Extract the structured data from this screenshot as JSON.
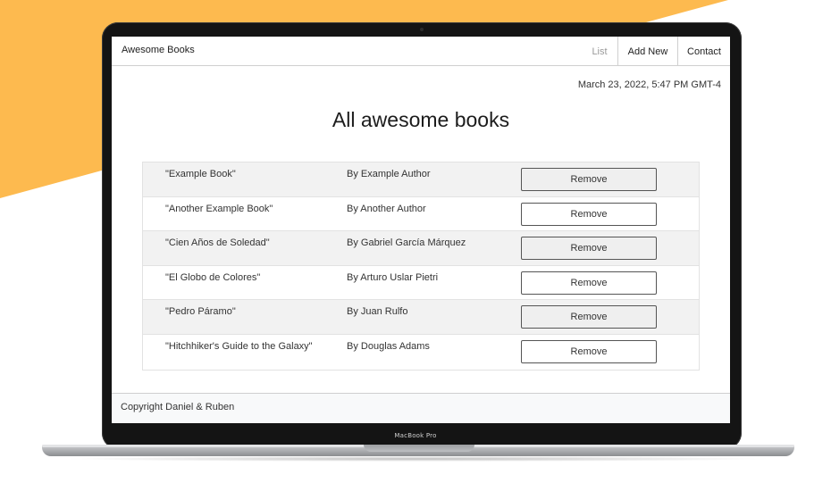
{
  "colors": {
    "accent_background": "#FDBA4F",
    "laptop_bezel": "#141414"
  },
  "device": {
    "label": "MacBook Pro"
  },
  "nav": {
    "brand": "Awesome Books",
    "links": [
      {
        "label": "List"
      },
      {
        "label": "Add New"
      },
      {
        "label": "Contact"
      }
    ]
  },
  "main": {
    "date": "March 23, 2022, 5:47 PM GMT-4",
    "heading": "All awesome books",
    "books": [
      {
        "title": "\"Example Book\"",
        "author": "By Example Author",
        "button": "Remove"
      },
      {
        "title": "\"Another Example Book\"",
        "author": "By Another Author",
        "button": "Remove"
      },
      {
        "title": "\"Cien Años de Soledad\"",
        "author": "By Gabriel García Márquez",
        "button": "Remove"
      },
      {
        "title": "\"El Globo de Colores\"",
        "author": "By Arturo Uslar Pietri",
        "button": "Remove"
      },
      {
        "title": "\"Pedro Páramo\"",
        "author": "By Juan Rulfo",
        "button": "Remove"
      },
      {
        "title": "\"Hitchhiker's Guide to the Galaxy\"",
        "author": "By Douglas Adams",
        "button": "Remove"
      }
    ]
  },
  "footer": {
    "text": "Copyright Daniel & Ruben"
  }
}
